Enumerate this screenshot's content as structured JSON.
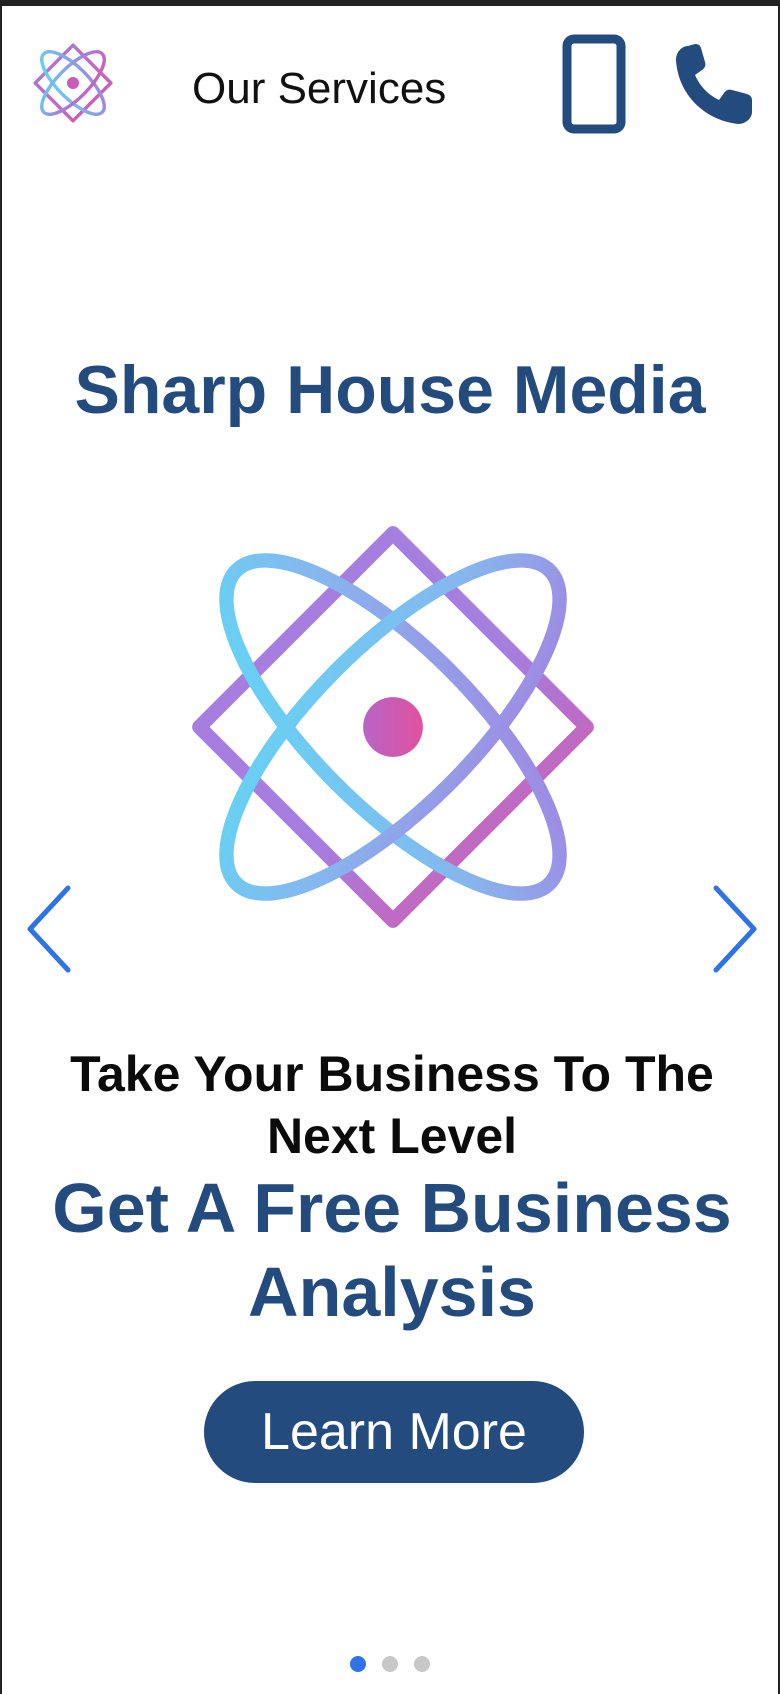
{
  "header": {
    "nav_title": "Our Services",
    "logo_icon": "atom-logo-icon",
    "mobile_icon": "smartphone-icon",
    "phone_icon": "phone-icon"
  },
  "slide": {
    "company_name": "Sharp House Media",
    "tagline": "Take Your Business To The Next Level",
    "offer": "Get A Free Business Analysis",
    "cta_label": "Learn More",
    "prev_icon": "chevron-left-icon",
    "next_icon": "chevron-right-icon"
  },
  "carousel": {
    "slide_count": 3,
    "active_index": 0
  },
  "colors": {
    "brand_blue": "#234b7e",
    "accent_blue": "#2f74e6",
    "gradient_cyan": "#5fd8f5",
    "gradient_purple": "#a57ee0",
    "gradient_pink": "#d857a8"
  }
}
